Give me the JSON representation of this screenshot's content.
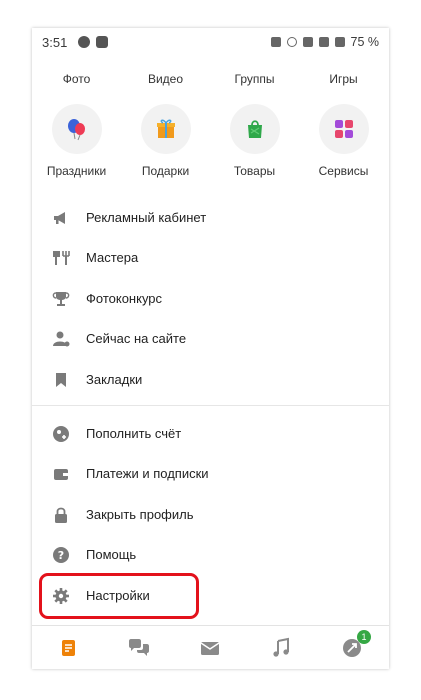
{
  "status_bar": {
    "time": "3:51",
    "battery": "75 %"
  },
  "top_row": [
    {
      "label": "Фото",
      "icon": "photo-icon"
    },
    {
      "label": "Видео",
      "icon": "video-icon"
    },
    {
      "label": "Группы",
      "icon": "groups-icon"
    },
    {
      "label": "Игры",
      "icon": "games-icon"
    }
  ],
  "grid_row": [
    {
      "label": "Праздники",
      "icon": "balloons-icon"
    },
    {
      "label": "Подарки",
      "icon": "gift-icon"
    },
    {
      "label": "Товары",
      "icon": "shopping-bag-icon"
    },
    {
      "label": "Сервисы",
      "icon": "services-icon"
    }
  ],
  "menu": {
    "items": [
      {
        "label": "Рекламный кабинет",
        "icon": "megaphone-icon"
      },
      {
        "label": "Мастера",
        "icon": "masters-icon"
      },
      {
        "label": "Фотоконкурс",
        "icon": "trophy-icon"
      },
      {
        "label": "Сейчас на сайте",
        "icon": "online-users-icon"
      },
      {
        "label": "Закладки",
        "icon": "bookmark-icon"
      }
    ],
    "items2": [
      {
        "label": "Пополнить счёт",
        "icon": "top-up-icon"
      },
      {
        "label": "Платежи и подписки",
        "icon": "wallet-icon"
      },
      {
        "label": "Закрыть профиль",
        "icon": "lock-icon"
      },
      {
        "label": "Помощь",
        "icon": "help-icon"
      },
      {
        "label": "Настройки",
        "icon": "settings-gear-icon"
      }
    ]
  },
  "bottom_nav": {
    "items": [
      {
        "name": "feed",
        "icon": "feed-icon"
      },
      {
        "name": "discussions",
        "icon": "chat-bubbles-icon"
      },
      {
        "name": "messages",
        "icon": "envelope-icon"
      },
      {
        "name": "music",
        "icon": "music-note-icon"
      },
      {
        "name": "notifications",
        "icon": "notifications-icon"
      }
    ],
    "badge_count": "1"
  },
  "colors": {
    "accent_orange": "#ee8208",
    "highlight_red": "#e3111b",
    "icon_gray": "#7a7a7a",
    "badge_green": "#35a844"
  }
}
